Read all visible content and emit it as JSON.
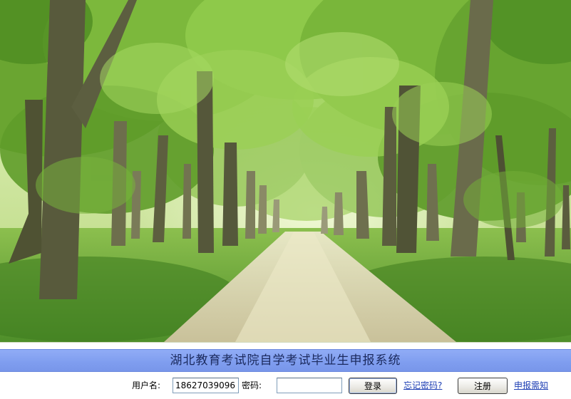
{
  "header": {
    "system_title": "湖北教育考试院自学考试毕业生申报系统"
  },
  "login": {
    "username_label": "用户名:",
    "username_value": "18627039096",
    "password_label": "密码:",
    "password_value": "",
    "login_button_label": "登录",
    "forgot_password_link": "忘记密码?",
    "register_button_label": "注册",
    "application_notice_link": "申报需知"
  },
  "hero_image": {
    "description_icon": "forest-path-photo"
  },
  "colors": {
    "title_bar": "#7f9def",
    "title_text": "#1b2a5e",
    "link": "#1e3fb4",
    "field_border": "#7f9db9"
  }
}
